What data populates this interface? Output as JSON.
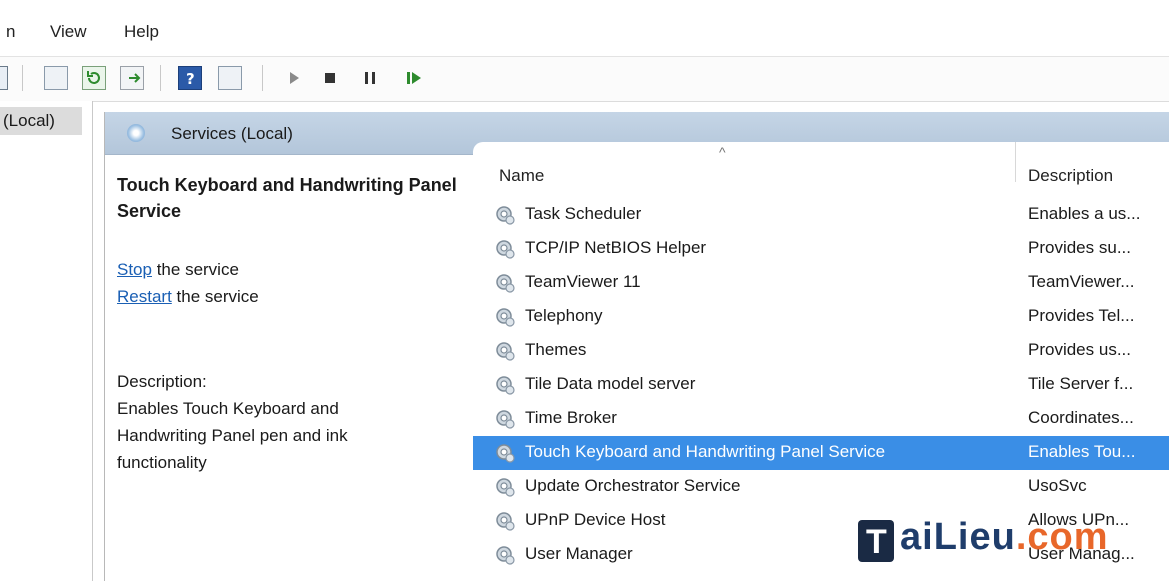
{
  "menu": {
    "items": [
      "n",
      "View",
      "Help"
    ]
  },
  "toolbar": {
    "icons": [
      "console-tree-icon",
      "properties-icon",
      "refresh-icon",
      "export-list-icon",
      "help-icon",
      "view-icon",
      "start-icon",
      "stop-icon",
      "pause-icon",
      "resume-icon"
    ]
  },
  "tree": {
    "selected_label": "(Local)"
  },
  "pane": {
    "title": "Services (Local)",
    "selected_service": "Touch Keyboard and Handwriting Panel Service",
    "actions": {
      "stop_link": "Stop",
      "stop_rest": " the service",
      "restart_link": "Restart",
      "restart_rest": " the service"
    },
    "description_label": "Description:",
    "description_text": "Enables Touch Keyboard and Handwriting Panel pen and ink functionality"
  },
  "list": {
    "sort_indicator": "^",
    "columns": {
      "name": "Name",
      "description": "Description"
    },
    "rows": [
      {
        "name": "Task Scheduler",
        "description": "Enables a us..."
      },
      {
        "name": "TCP/IP NetBIOS Helper",
        "description": "Provides su..."
      },
      {
        "name": "TeamViewer 11",
        "description": "TeamViewer..."
      },
      {
        "name": "Telephony",
        "description": "Provides Tel..."
      },
      {
        "name": "Themes",
        "description": "Provides us..."
      },
      {
        "name": "Tile Data model server",
        "description": "Tile Server f..."
      },
      {
        "name": "Time Broker",
        "description": "Coordinates..."
      },
      {
        "name": "Touch Keyboard and Handwriting Panel Service",
        "description": "Enables Tou...",
        "selected": true
      },
      {
        "name": "Update Orchestrator Service",
        "description": "UsoSvc"
      },
      {
        "name": "UPnP Device Host",
        "description": "Allows UPn..."
      },
      {
        "name": "User Manager",
        "description": "User Manag..."
      }
    ]
  },
  "watermark": {
    "letter": "T",
    "text": "aiLieu",
    "suffix": ".com"
  },
  "colors": {
    "selection": "#3a8ee6",
    "header": "#c5d5e6",
    "link": "#1a5fb4"
  }
}
